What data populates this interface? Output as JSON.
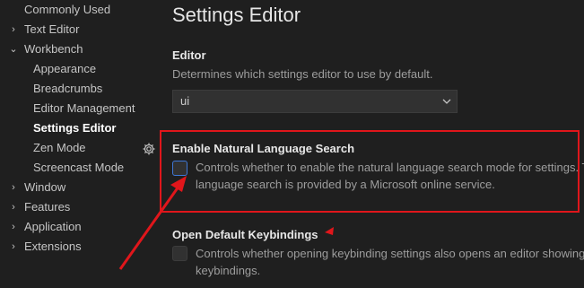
{
  "sidebar": {
    "items": [
      {
        "label": "Commonly Used",
        "chevron": ""
      },
      {
        "label": "Text Editor",
        "chevron": ">"
      },
      {
        "label": "Workbench",
        "chevron": "v"
      },
      {
        "label": "Appearance",
        "chevron": ""
      },
      {
        "label": "Breadcrumbs",
        "chevron": ""
      },
      {
        "label": "Editor Management",
        "chevron": ""
      },
      {
        "label": "Settings Editor",
        "chevron": "",
        "active": true
      },
      {
        "label": "Zen Mode",
        "chevron": ""
      },
      {
        "label": "Screencast Mode",
        "chevron": ""
      },
      {
        "label": "Window",
        "chevron": ">"
      },
      {
        "label": "Features",
        "chevron": ">"
      },
      {
        "label": "Application",
        "chevron": ">"
      },
      {
        "label": "Extensions",
        "chevron": ">"
      }
    ]
  },
  "settings": {
    "page_title": "Settings Editor",
    "editor": {
      "title": "Editor",
      "description": "Determines which settings editor to use by default.",
      "value": "ui"
    },
    "natural_language_search": {
      "title": "Enable Natural Language Search",
      "description_line1": "Controls whether to enable the natural language search mode for settings. The natural",
      "description_line2": "language search is provided by a Microsoft online service.",
      "checked": false
    },
    "open_default_keybindings": {
      "title": "Open Default Keybindings",
      "description_line1": "Controls whether opening keybinding settings also opens an editor showing all default",
      "description_line2": "keybindings.",
      "checked": false
    }
  },
  "colors": {
    "background": "#1f1f1f",
    "annotation_red": "#e0161b",
    "focus_blue": "#3e77d6"
  }
}
